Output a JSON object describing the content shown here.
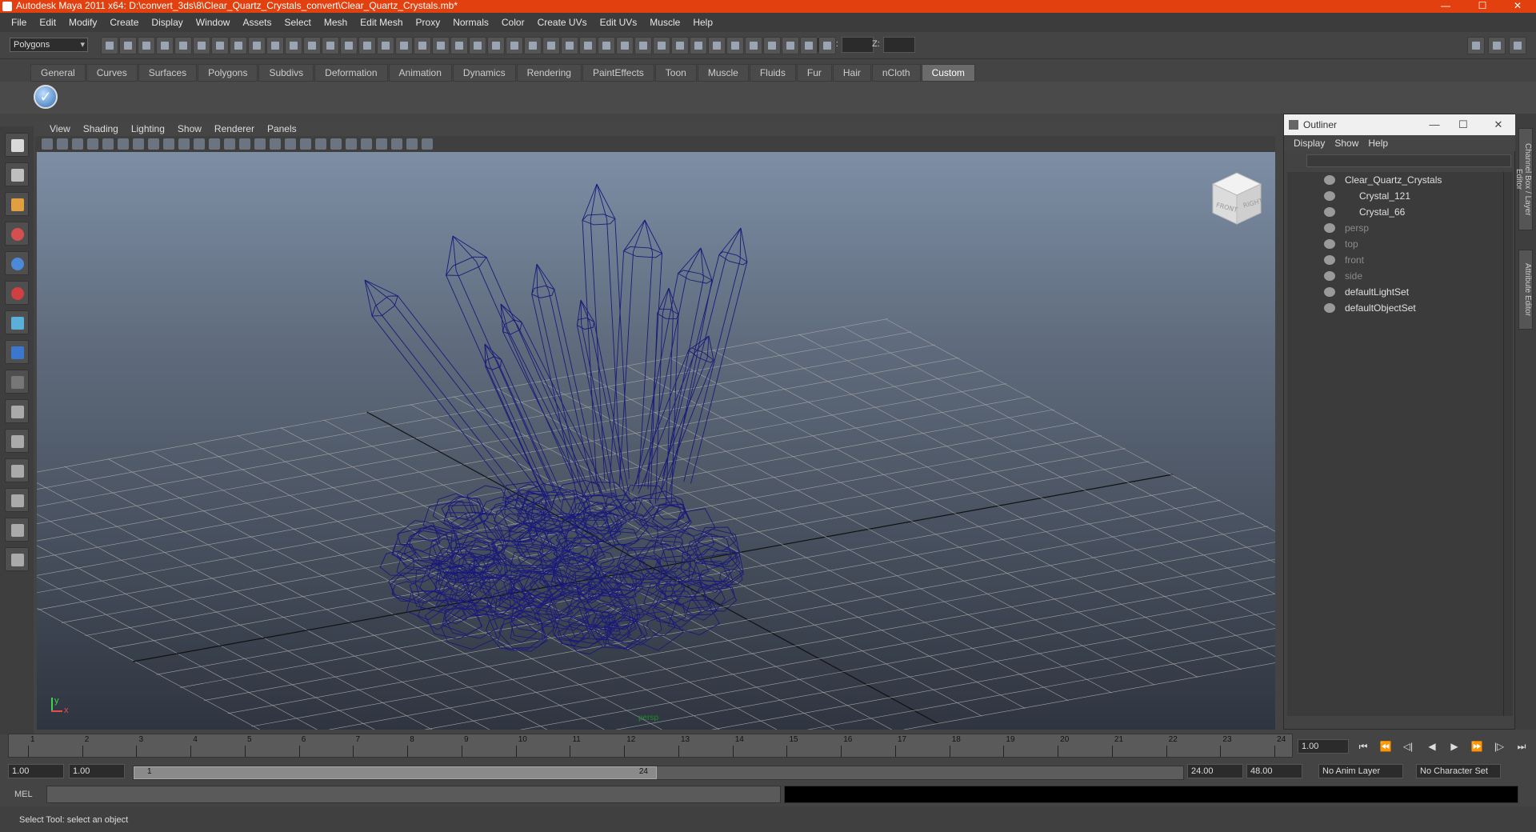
{
  "window": {
    "title": "Autodesk Maya 2011 x64: D:\\convert_3ds\\8\\Clear_Quartz_Crystals_convert\\Clear_Quartz_Crystals.mb*",
    "controls": [
      "—",
      "☐",
      "✕"
    ]
  },
  "menubar": [
    "File",
    "Edit",
    "Modify",
    "Create",
    "Display",
    "Window",
    "Assets",
    "Select",
    "Mesh",
    "Edit Mesh",
    "Proxy",
    "Normals",
    "Color",
    "Create UVs",
    "Edit UVs",
    "Muscle",
    "Help"
  ],
  "statusline": {
    "mode": "Polygons",
    "x_label": "X:",
    "y_label": "Y:",
    "z_label": "Z:"
  },
  "shelf": {
    "tabs": [
      "General",
      "Curves",
      "Surfaces",
      "Polygons",
      "Subdivs",
      "Deformation",
      "Animation",
      "Dynamics",
      "Rendering",
      "PaintEffects",
      "Toon",
      "Muscle",
      "Fluids",
      "Fur",
      "Hair",
      "nCloth",
      "Custom"
    ],
    "active_tab": "Custom"
  },
  "viewport": {
    "menu": [
      "View",
      "Shading",
      "Lighting",
      "Show",
      "Renderer",
      "Panels"
    ],
    "camera_label": "persp",
    "axis_x": "x",
    "axis_y": "y",
    "viewcube_faces": [
      "FRONT",
      "RIGHT"
    ],
    "wire_color": "#1a1a7a"
  },
  "outliner": {
    "title": "Outliner",
    "menu": [
      "Display",
      "Show",
      "Help"
    ],
    "items": [
      {
        "label": "Clear_Quartz_Crystals",
        "dim": false
      },
      {
        "label": "Crystal_121",
        "dim": false
      },
      {
        "label": "Crystal_66",
        "dim": false
      },
      {
        "label": "persp",
        "dim": true
      },
      {
        "label": "top",
        "dim": true
      },
      {
        "label": "front",
        "dim": true
      },
      {
        "label": "side",
        "dim": true
      },
      {
        "label": "defaultLightSet",
        "dim": false
      },
      {
        "label": "defaultObjectSet",
        "dim": false
      }
    ]
  },
  "side_tabs": [
    "Channel Box / Layer Editor",
    "Attribute Editor"
  ],
  "timeline": {
    "frames": [
      "1",
      "2",
      "3",
      "4",
      "5",
      "6",
      "7",
      "8",
      "9",
      "10",
      "11",
      "12",
      "13",
      "14",
      "15",
      "16",
      "17",
      "18",
      "19",
      "20",
      "21",
      "22",
      "23",
      "24"
    ],
    "current_frame": "1.00"
  },
  "range": {
    "start": "1.00",
    "playback_start": "1.00",
    "slider_start": "1",
    "slider_end": "24",
    "playback_end": "24.00",
    "end": "48.00",
    "anim_layer": "No Anim Layer",
    "character_set": "No Character Set"
  },
  "command": {
    "label": "MEL"
  },
  "help_line": "Select Tool: select an object"
}
